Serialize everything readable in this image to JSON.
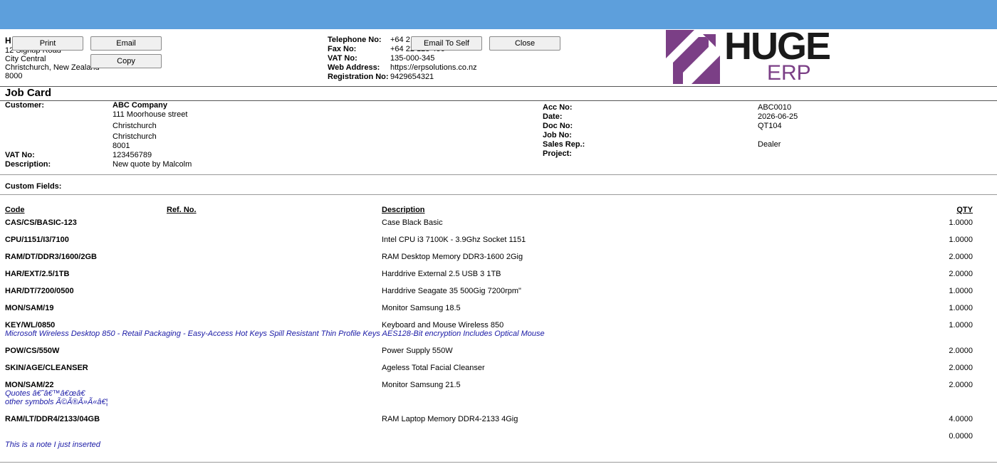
{
  "buttons": {
    "print": "Print",
    "email": "Email",
    "copy": "Copy",
    "email_self": "Email To Self",
    "close": "Close"
  },
  "company": {
    "name_initial": "H",
    "address": [
      "12 Signup Road",
      "City Central",
      "Christchurch, New Zealand",
      "8000"
    ],
    "contact_labels": [
      "Telephone No:",
      "Fax No:",
      "VAT No:",
      "Web Address:",
      "Registration No:"
    ],
    "contact_values": [
      "+64 2",
      "+64 22 123 456",
      "135-000-345",
      "https://erpsolutions.co.nz",
      "9429654321"
    ]
  },
  "logo": {
    "line1": "HUGE",
    "line2": "ERP",
    "color_purple": "#7b3f86",
    "color_dark": "#1a1a1a"
  },
  "doc_title": "Job Card",
  "customer": {
    "label": "Customer:",
    "name": "ABC Company",
    "address": [
      "111 Moorhouse street",
      "Christchurch",
      "Christchurch",
      "8001"
    ],
    "vat_label": "VAT No:",
    "vat": "123456789",
    "desc_label": "Description:",
    "desc": "New quote by Malcolm"
  },
  "doc_info": {
    "labels": [
      "Acc No:",
      "Date:",
      "Doc No:",
      "Job No:",
      "Sales Rep.:",
      "Project:"
    ],
    "values": [
      "ABC0010",
      "2026-06-25",
      "QT104",
      "",
      "Dealer",
      ""
    ]
  },
  "custom_fields_label": "Custom Fields:",
  "table": {
    "headers": {
      "code": "Code",
      "ref": "Ref. No.",
      "description": "Description",
      "qty": "QTY"
    },
    "rows": [
      {
        "code": "CAS/CS/BASIC-123",
        "description": "Case Black Basic",
        "qty": "1.0000"
      },
      {
        "code": "CPU/1151/I3/7100",
        "description": "Intel CPU i3 7100K - 3.9Ghz Socket 1151",
        "qty": "1.0000"
      },
      {
        "code": "RAM/DT/DDR3/1600/2GB",
        "description": "RAM Desktop Memory DDR3-1600 2Gig",
        "qty": "2.0000"
      },
      {
        "code": "HAR/EXT/2.5/1TB",
        "description": "Harddrive External 2.5 USB 3 1TB",
        "qty": "2.0000"
      },
      {
        "code": "HAR/DT/7200/0500",
        "description": "Harddrive Seagate 35 500Gig 7200rpm\"",
        "qty": "1.0000"
      },
      {
        "code": "MON/SAM/19",
        "description": "Monitor Samsung 18.5",
        "qty": "1.0000"
      },
      {
        "code": "KEY/WL/0850",
        "description": "Keyboard and Mouse Wireless 850",
        "qty": "1.0000"
      },
      {
        "code": "POW/CS/550W",
        "description": "Power Supply 550W",
        "qty": "2.0000"
      },
      {
        "code": "SKIN/AGE/CLEANSER",
        "description": "Ageless Total Facial Cleanser",
        "qty": "2.0000"
      },
      {
        "code": "MON/SAM/22",
        "description": "Monitor Samsung 21.5",
        "qty": "2.0000"
      },
      {
        "code": "RAM/LT/DDR4/2133/04GB",
        "description": "RAM Laptop Memory DDR4-2133 4Gig",
        "qty": "4.0000"
      },
      {
        "code": "",
        "description": "",
        "qty": "0.0000"
      }
    ],
    "notes": {
      "key": "Microsoft Wireless Desktop 850 - Retail Packaging - Easy-Access Hot Keys Spill Resistant Thin Profile Keys AES128-Bit encryption Includes Optical Mouse",
      "mon22_a": "Quotes â€˜â€™â€œâ€",
      "mon22_b": "other symbols Ã©Ã®Ã»Ã«â€¦",
      "last": "This is a note I just inserted"
    }
  }
}
